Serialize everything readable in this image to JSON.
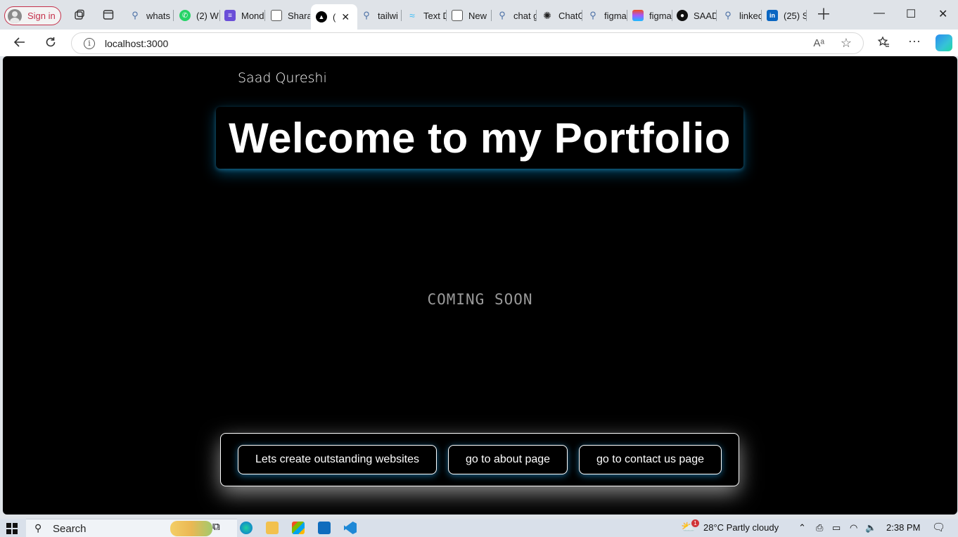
{
  "browser": {
    "signin_label": "Sign in",
    "tabs": [
      {
        "label": "whats",
        "icon": "search-icon"
      },
      {
        "label": "(2) W",
        "icon": "whatsapp-icon"
      },
      {
        "label": "Mond",
        "icon": "monday-icon"
      },
      {
        "label": "Shara",
        "icon": "document-icon"
      },
      {
        "label": "(",
        "icon": "vercel-icon",
        "active": true
      },
      {
        "label": "tailwi",
        "icon": "search-icon"
      },
      {
        "label": "Text D",
        "icon": "tailwind-icon"
      },
      {
        "label": "New",
        "icon": "newtab-icon"
      },
      {
        "label": "chat g",
        "icon": "search-icon"
      },
      {
        "label": "ChatG",
        "icon": "openai-icon"
      },
      {
        "label": "figma",
        "icon": "search-icon"
      },
      {
        "label": "figma",
        "icon": "figma-icon"
      },
      {
        "label": "SAAD",
        "icon": "github-icon"
      },
      {
        "label": "linked",
        "icon": "search-icon"
      },
      {
        "label": "(25) S",
        "icon": "linkedin-icon"
      }
    ],
    "url": "localhost:3000",
    "read_aloud": "Aᵃ"
  },
  "page": {
    "brand": "Saad Qureshi",
    "hero_title": "Welcome to my Portfolio",
    "coming_soon": "COMING SOON",
    "buttons": [
      {
        "label": "Lets create outstanding websites"
      },
      {
        "label": "go to about page"
      },
      {
        "label": "go to contact us page"
      }
    ]
  },
  "taskbar": {
    "search_label": "Search",
    "weather": "28°C  Partly cloudy",
    "weather_badge": "1",
    "time": "2:38 PM"
  }
}
